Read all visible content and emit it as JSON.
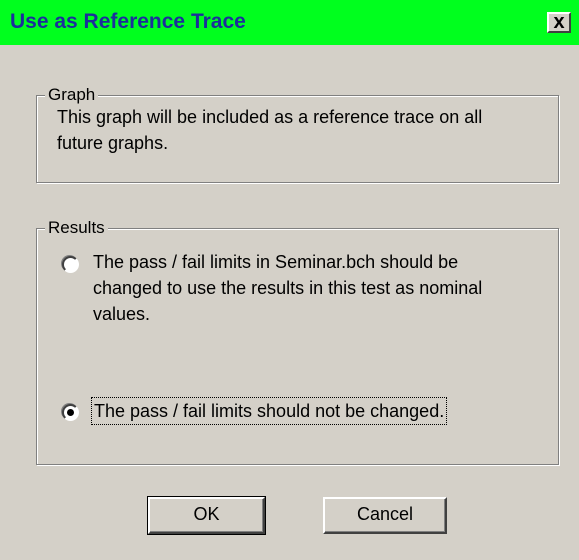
{
  "dialog": {
    "title": "Use as Reference Trace",
    "close_label": "x"
  },
  "graph_group": {
    "legend": "Graph",
    "text": "This graph will be included as a reference trace on all future graphs."
  },
  "results_group": {
    "legend": "Results",
    "options": [
      {
        "label": "The pass / fail limits in Seminar.bch should be changed to use the results in this test as nominal values.",
        "selected": false
      },
      {
        "label": "The pass / fail limits should not be changed.",
        "selected": true
      }
    ]
  },
  "buttons": {
    "ok": "OK",
    "cancel": "Cancel"
  },
  "colors": {
    "title_bar": "#00ff1e",
    "title_text": "#1b2f9c",
    "dialog_bg": "#d4d0c8"
  }
}
